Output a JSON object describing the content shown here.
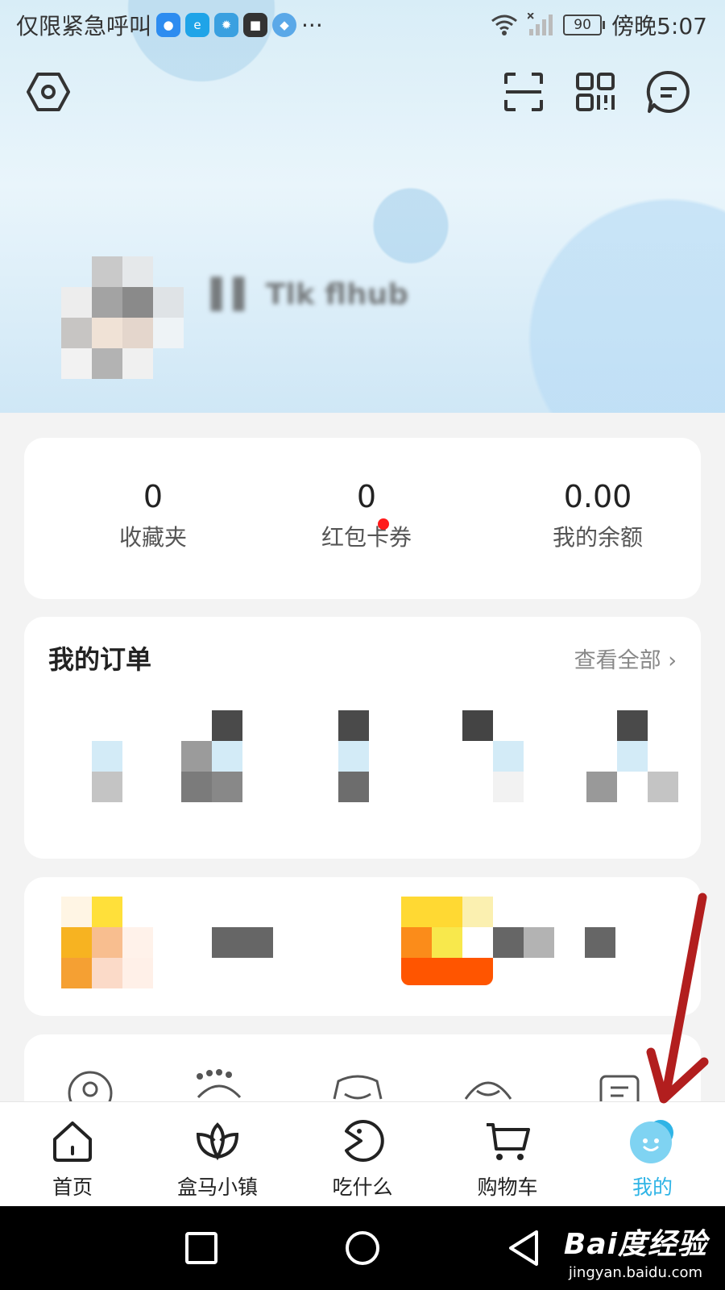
{
  "status_bar": {
    "carrier_text": "仅限紧急呼叫",
    "more": "···",
    "battery": "90",
    "time": "傍晚5:07"
  },
  "header": {
    "username": "▌▌ Tlk flhub"
  },
  "stats": [
    {
      "value": "0",
      "label": "收藏夹",
      "has_dot": false
    },
    {
      "value": "0",
      "label": "红包卡券",
      "has_dot": true
    },
    {
      "value": "0.00",
      "label": "我的余额",
      "has_dot": false
    }
  ],
  "orders": {
    "title": "我的订单",
    "view_all": "查看全部",
    "chevron": "›"
  },
  "tabbar": {
    "items": [
      {
        "label": "首页",
        "icon": "home-icon",
        "active": false
      },
      {
        "label": "盒马小镇",
        "icon": "lotus-icon",
        "active": false
      },
      {
        "label": "吃什么",
        "icon": "pacman-icon",
        "active": false
      },
      {
        "label": "购物车",
        "icon": "cart-icon",
        "active": false
      },
      {
        "label": "我的",
        "icon": "mascot-icon",
        "active": true
      }
    ]
  },
  "watermark": {
    "brand": "Bai度经验",
    "url": "jingyan.baidu.com"
  },
  "colors": {
    "accent": "#2fb4e6",
    "annotation_arrow": "#b21e1e",
    "badge": "#ff1a1a"
  }
}
